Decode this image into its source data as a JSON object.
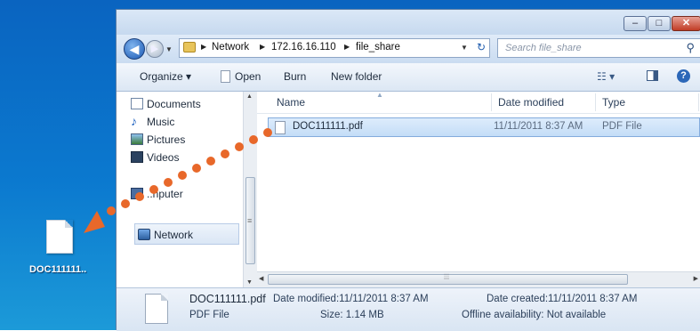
{
  "desktop": {
    "file_label": "DOC111111.."
  },
  "window": {
    "buttons": {
      "minimize": "–",
      "maximize": "□",
      "close": "✕"
    },
    "nav": {
      "back": "◀",
      "forward": "▶",
      "breadcrumb": [
        "Network",
        "172.16.16.110",
        "file_share"
      ],
      "separator": "▶",
      "dropdown": "▼",
      "refresh": "↻",
      "search_placeholder": "Search file_share",
      "search_icon": "search-icon"
    },
    "toolbar": {
      "organize": "Organize ▾",
      "open": "Open",
      "burn": "Burn",
      "new_folder": "New folder",
      "views": "☷ ▾",
      "help": "?"
    },
    "sidebar": {
      "items": [
        {
          "label": "Documents",
          "icon": "documents-icon"
        },
        {
          "label": "Music",
          "icon": "music-icon"
        },
        {
          "label": "Pictures",
          "icon": "pictures-icon"
        },
        {
          "label": "Videos",
          "icon": "videos-icon"
        },
        {
          "label": "..nputer",
          "icon": "computer-icon"
        },
        {
          "label": "Network",
          "icon": "network-icon",
          "selected": true
        }
      ],
      "music_glyph": "♪"
    },
    "columns": {
      "name": "Name",
      "date_modified": "Date modified",
      "type": "Type"
    },
    "files": [
      {
        "name": "DOC111111.pdf",
        "date_modified": "11/11/2011 8:37 AM",
        "type": "PDF File",
        "selected": true
      }
    ],
    "details": {
      "file_name": "DOC111111.pdf",
      "file_type": "PDF File",
      "date_modified_label": "Date modified:",
      "date_modified": "11/11/2011 8:37 AM",
      "size_label": "Size:",
      "size": "1.14 MB",
      "date_created_label": "Date created:",
      "date_created": "11/11/2011 8:37 AM",
      "offline_label": "Offline availability:",
      "offline": "Not available"
    }
  },
  "colors": {
    "desktop": "#0b79cf",
    "selection": "#c4ddf7",
    "drag_arrow": "#e8682a"
  }
}
